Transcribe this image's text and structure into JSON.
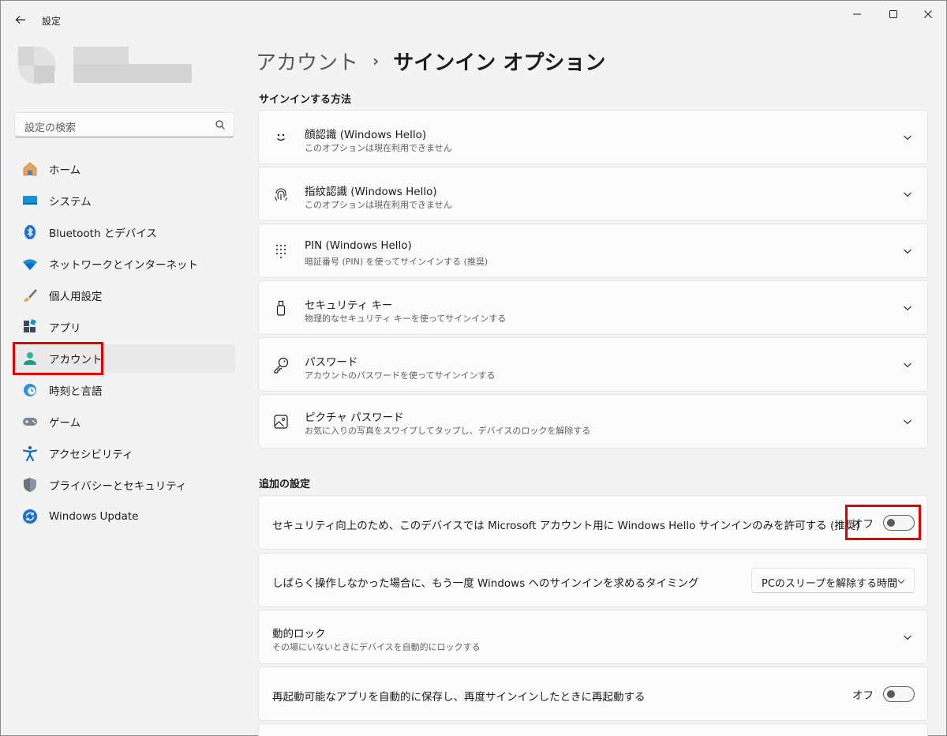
{
  "window": {
    "title": "設定"
  },
  "search": {
    "placeholder": "設定の検索"
  },
  "sidebar": {
    "items": [
      {
        "label": "ホーム",
        "icon": "home-icon"
      },
      {
        "label": "システム",
        "icon": "system-icon"
      },
      {
        "label": "Bluetooth とデバイス",
        "icon": "bluetooth-icon"
      },
      {
        "label": "ネットワークとインターネット",
        "icon": "wifi-icon"
      },
      {
        "label": "個人用設定",
        "icon": "brush-icon"
      },
      {
        "label": "アプリ",
        "icon": "apps-icon"
      },
      {
        "label": "アカウント",
        "icon": "account-icon",
        "active": true
      },
      {
        "label": "時刻と言語",
        "icon": "time-language-icon"
      },
      {
        "label": "ゲーム",
        "icon": "gamepad-icon"
      },
      {
        "label": "アクセシビリティ",
        "icon": "accessibility-icon"
      },
      {
        "label": "プライバシーとセキュリティ",
        "icon": "shield-icon"
      },
      {
        "label": "Windows Update",
        "icon": "windows-update-icon"
      }
    ]
  },
  "breadcrumb": {
    "parent": "アカウント",
    "separator": "›",
    "current": "サインイン オプション"
  },
  "signin": {
    "heading": "サインインする方法",
    "options": [
      {
        "title": "顔認識 (Windows Hello)",
        "subtitle": "このオプションは現在利用できません",
        "icon": "face-icon"
      },
      {
        "title": "指紋認識 (Windows Hello)",
        "subtitle": "このオプションは現在利用できません",
        "icon": "fingerprint-icon"
      },
      {
        "title": "PIN (Windows Hello)",
        "subtitle": "暗証番号 (PIN) を使ってサインインする (推奨)",
        "icon": "pin-keypad-icon"
      },
      {
        "title": "セキュリティ キー",
        "subtitle": "物理的なセキュリティ キーを使ってサインインする",
        "icon": "usb-key-icon"
      },
      {
        "title": "パスワード",
        "subtitle": "アカウントのパスワードを使ってサインインする",
        "icon": "key-icon"
      },
      {
        "title": "ピクチャ パスワード",
        "subtitle": "お気に入りの写真をスワイプしてタップし、デバイスのロックを解除する",
        "icon": "picture-icon"
      }
    ]
  },
  "additional": {
    "heading": "追加の設定",
    "hello_only": {
      "text": "セキュリティ向上のため、このデバイスでは Microsoft アカウント用に Windows Hello サインインのみを許可する (推奨)",
      "state": "オフ"
    },
    "timeout": {
      "text": "しばらく操作しなかった場合に、もう一度 Windows へのサインインを求めるタイミング",
      "value": "PCのスリープを解除する時間"
    },
    "dynamic_lock": {
      "title": "動的ロック",
      "subtitle": "その場にいないときにデバイスを自動的にロックする"
    },
    "restart_apps": {
      "text": "再起動可能なアプリを自動的に保存し、再度サインインしたときに再起動する",
      "state": "オフ"
    }
  },
  "colors": {
    "accent": "#0067c0",
    "highlight": "#e00000"
  }
}
